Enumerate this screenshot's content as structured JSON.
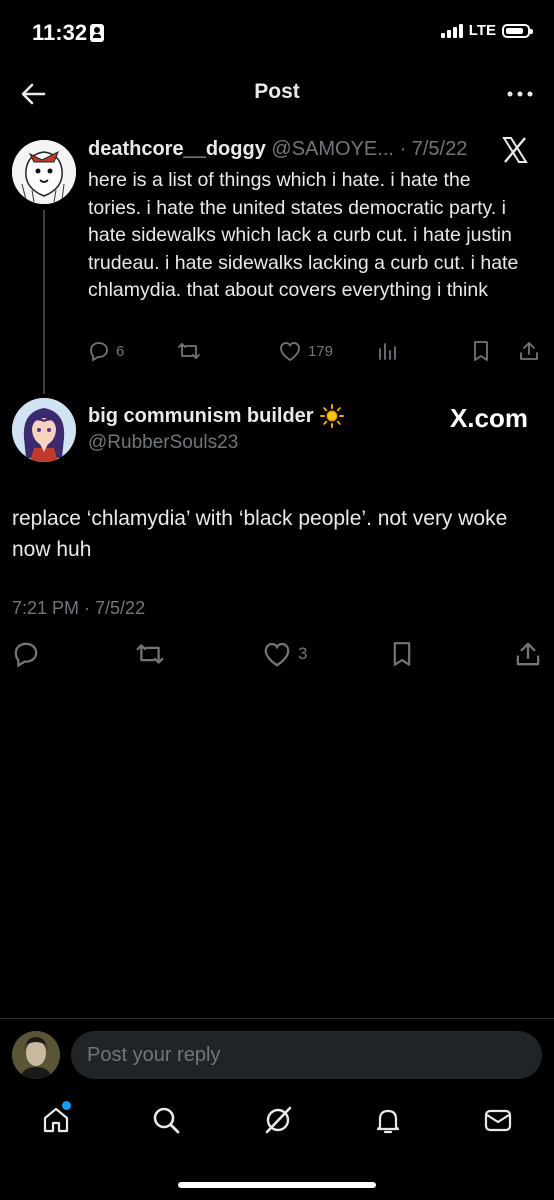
{
  "status_bar": {
    "time": "11:32",
    "network": "LTE"
  },
  "nav": {
    "title": "Post"
  },
  "parent_post": {
    "display_name": "deathcore__doggy",
    "handle_date": "@SAMOYE... · 7/5/22",
    "text": "here is a list of things which i hate. i hate the tories. i hate the united states democratic party. i hate sidewalks which lack a curb cut. i hate justin trudeau. i hate sidewalks lacking a curb cut. i hate chlamydia.  that about covers everything i think",
    "replies": "6",
    "likes": "179"
  },
  "main_post": {
    "display_name": "big communism builder",
    "handle": "@RubberSouls23",
    "watermark": "X.com",
    "text": "replace ‘chlamydia’ with ‘black people’. not very woke now huh",
    "timestamp": "7:21 PM · 7/5/22",
    "likes": "3"
  },
  "reply": {
    "placeholder": "Post your reply"
  },
  "colors": {
    "background": "#000000",
    "muted": "#71767b",
    "accent": "#1d9bf0"
  },
  "icons": [
    "back-arrow-icon",
    "more-icon",
    "x-logo-icon",
    "reply-icon",
    "repost-icon",
    "like-icon",
    "views-icon",
    "bookmark-icon",
    "share-icon",
    "sun-icon",
    "home-icon",
    "search-icon",
    "grok-icon",
    "notifications-icon",
    "messages-icon"
  ]
}
